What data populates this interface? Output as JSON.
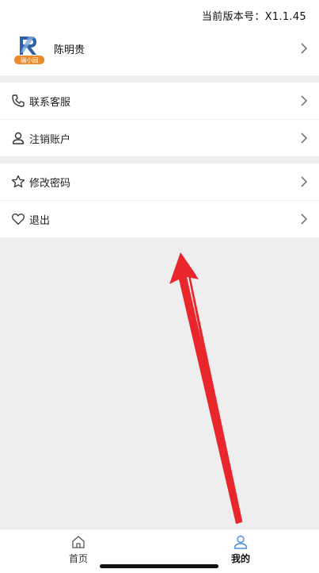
{
  "header": {
    "version_text": "当前版本号：X1.1.45"
  },
  "profile": {
    "name": "陈明贵",
    "logo_text": "瑞小园"
  },
  "menu_group_1": [
    {
      "label": "联系客服",
      "icon": "phone-icon"
    },
    {
      "label": "注销账户",
      "icon": "user-icon"
    }
  ],
  "menu_group_2": [
    {
      "label": "修改密码",
      "icon": "star-icon"
    },
    {
      "label": "退出",
      "icon": "heart-icon"
    }
  ],
  "tabbar": {
    "home_label": "首页",
    "mine_label": "我的",
    "active": "mine"
  },
  "colors": {
    "background": "#eeeeee",
    "accent_blue": "#4a90d9",
    "logo_orange": "#e98a2c",
    "annotation_arrow": "#e8262b"
  }
}
